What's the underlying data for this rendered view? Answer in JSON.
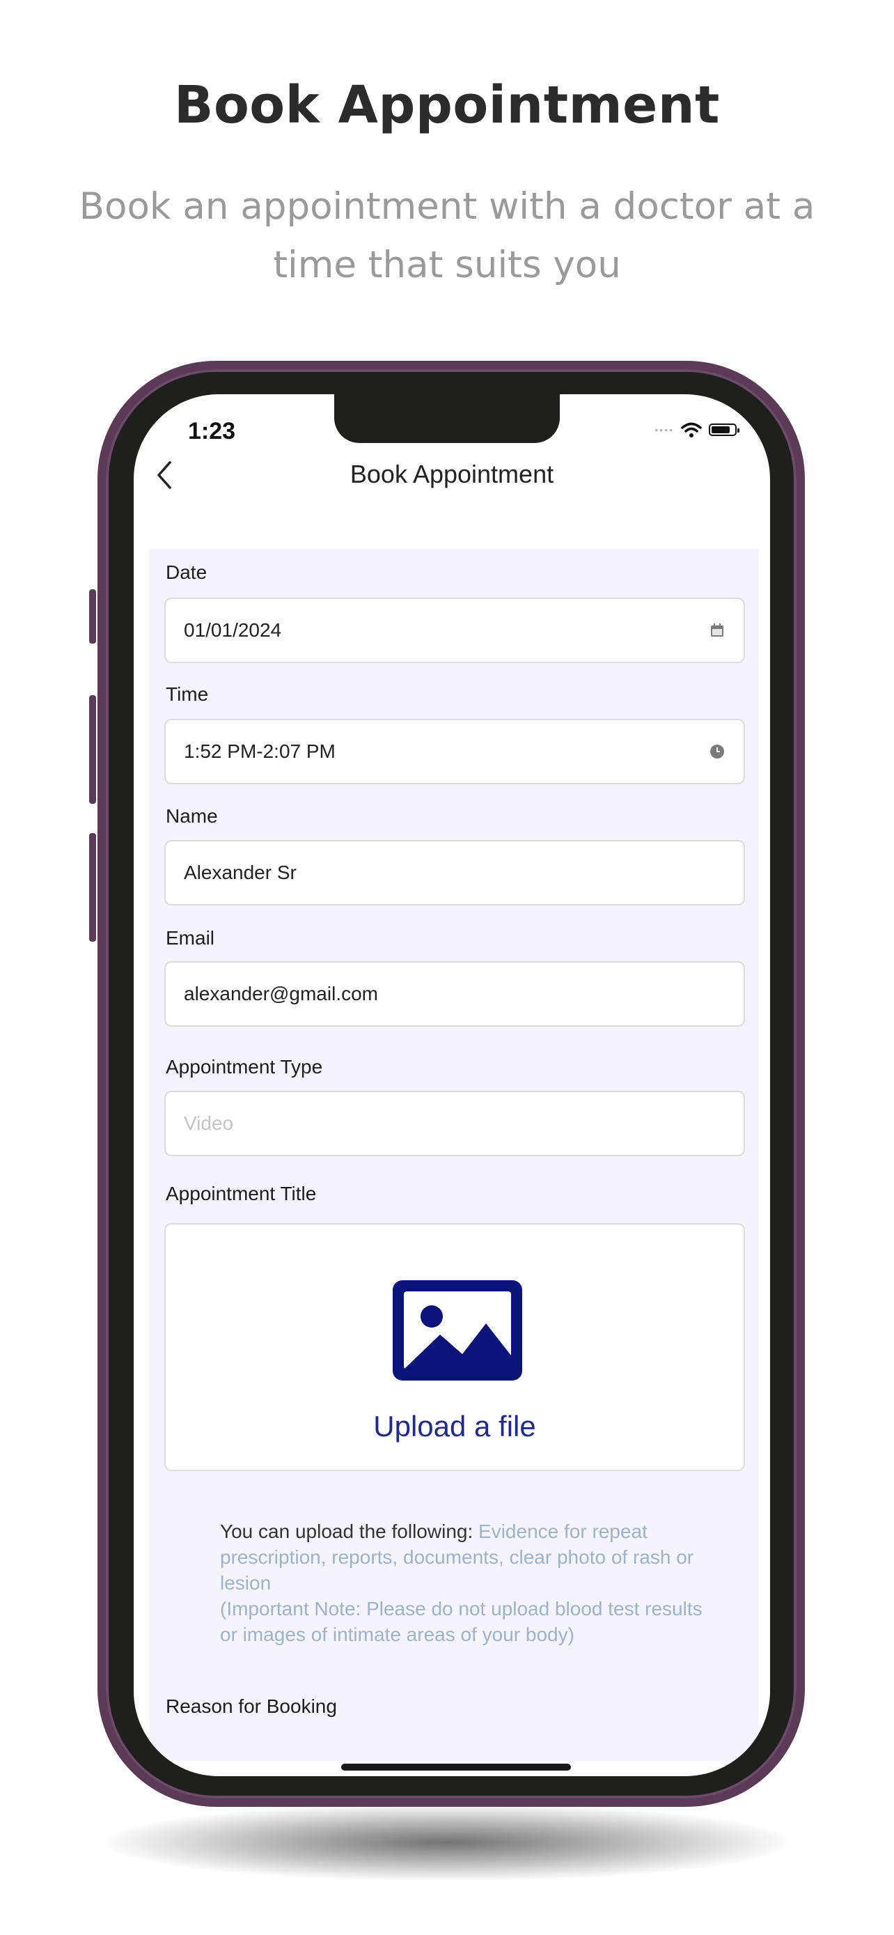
{
  "promo": {
    "title": "Book Appointment",
    "subtitle": "Book an appointment with a doctor at a time that suits you"
  },
  "status_bar": {
    "time": "1:23",
    "icons": [
      "signal-icon",
      "wifi-icon",
      "battery-icon"
    ]
  },
  "nav": {
    "back_icon": "chevron-left-icon",
    "title": "Book Appointment"
  },
  "form": {
    "date": {
      "label": "Date",
      "value": "01/01/2024",
      "icon": "calendar-icon"
    },
    "time": {
      "label": "Time",
      "value": "1:52 PM-2:07 PM",
      "icon": "clock-icon"
    },
    "name": {
      "label": "Name",
      "value": "Alexander Sr"
    },
    "email": {
      "label": "Email",
      "value": "alexander@gmail.com"
    },
    "appointment_type": {
      "label": "Appointment Type",
      "placeholder": "Video"
    },
    "appointment_title": {
      "label": "Appointment Title"
    },
    "upload": {
      "icon": "image-icon",
      "label": "Upload a file",
      "hint_lead": "You can upload the following: ",
      "hint_body": "Evidence for repeat prescription, reports, documents, clear photo of rash or lesion",
      "hint_note": "(Important Note: Please do not upload blood test results or images of intimate areas of your body)"
    },
    "reason": {
      "label": "Reason for Booking"
    }
  },
  "colors": {
    "accent": "#1f2a8a",
    "icon_fill": "#0b1478",
    "form_background": "#f5f4fd",
    "phone_frame": "#5a3a55",
    "hint": "#9fb2c8"
  }
}
